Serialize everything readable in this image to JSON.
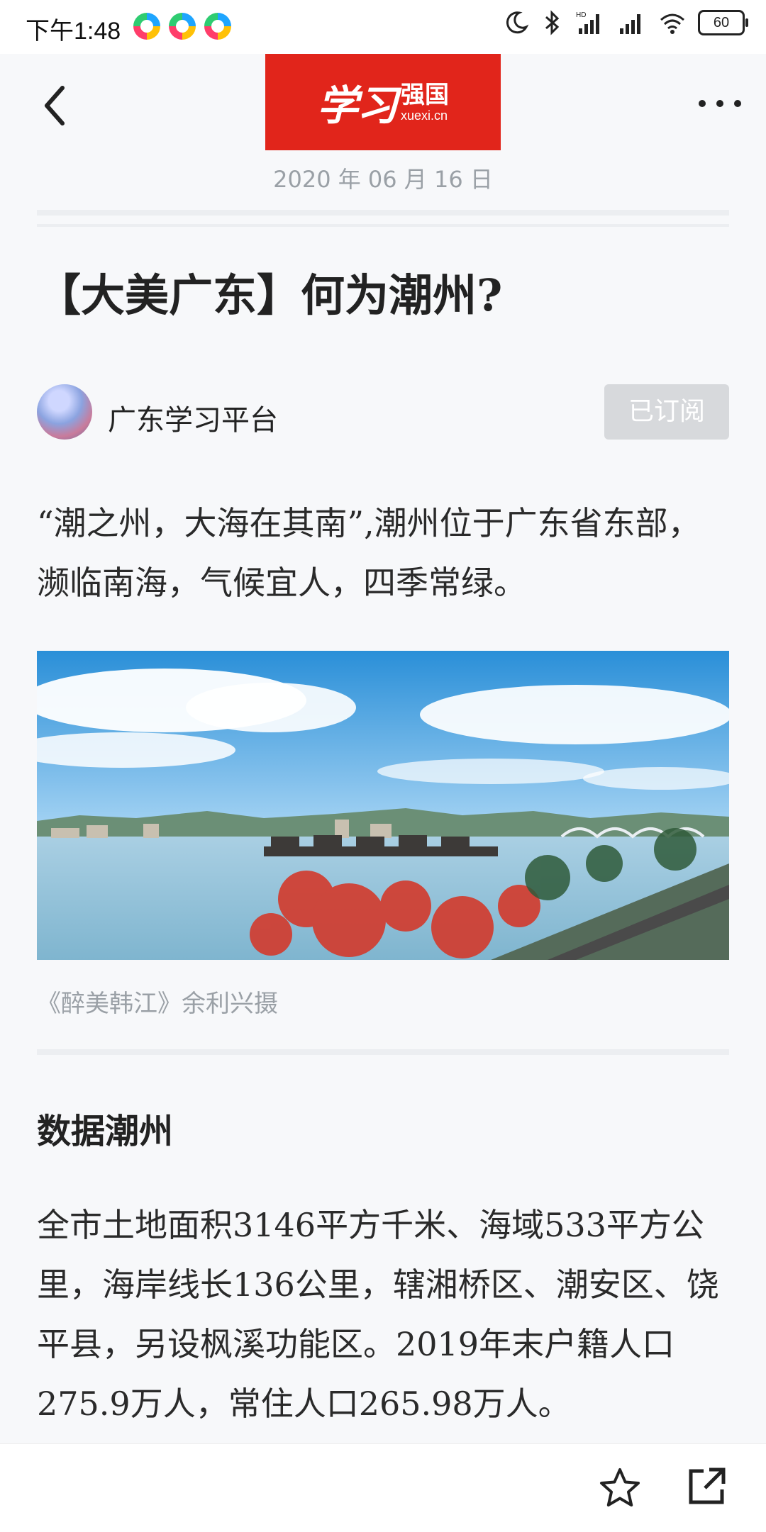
{
  "status_bar": {
    "time": "下午1:48",
    "battery": "60",
    "network_badge": "HD"
  },
  "header": {
    "logo_script": "学习",
    "logo_strong": "强国",
    "logo_url": "xuexi.cn",
    "date": "2020 年 06 月 16 日"
  },
  "article": {
    "title": "【大美广东】何为潮州?",
    "author": "广东学习平台",
    "subscribe_label": "已订阅",
    "intro": "“潮之州，大海在其南”,潮州位于广东省东部，濒临南海，气候宜人，四季常绿。",
    "image_caption": "《醉美韩江》余利兴摄",
    "section_title": "数据潮州",
    "section_text": "全市土地面积3146平方千米、海域533平方公里，海岸线长136公里，辖湘桥区、潮安区、饶平县，另设枫溪功能区。2019年末户籍人口275.9万人，常住人口265.98万人。"
  },
  "colors": {
    "brand_red": "#e1251b",
    "muted_text": "#9aa0a6",
    "subscribed_bg": "#d7d9dc"
  },
  "icons": [
    "back-arrow-icon",
    "more-dots-icon",
    "star-icon",
    "share-external-icon",
    "moon-icon",
    "bluetooth-icon",
    "signal-icon",
    "wifi-icon"
  ]
}
